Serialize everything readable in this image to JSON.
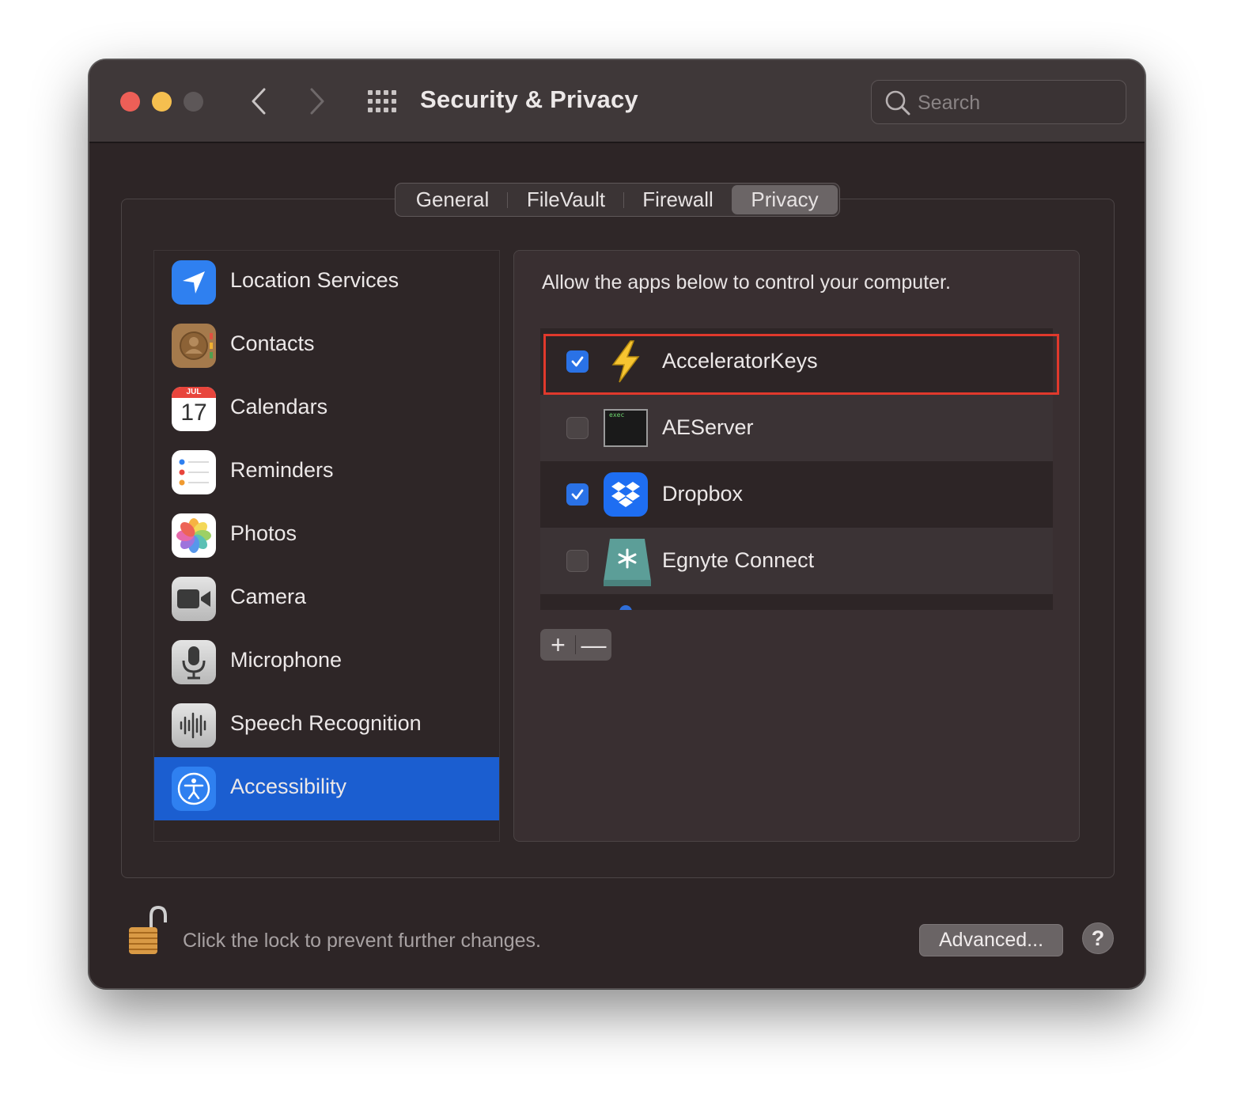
{
  "window": {
    "title": "Security & Privacy"
  },
  "toolbar": {
    "back_icon": "chevron-left-icon",
    "forward_icon": "chevron-right-icon",
    "grid_icon": "show-all-grid-icon"
  },
  "search": {
    "placeholder": "Search",
    "value": ""
  },
  "tabs": [
    {
      "label": "General",
      "selected": false
    },
    {
      "label": "FileVault",
      "selected": false
    },
    {
      "label": "Firewall",
      "selected": false
    },
    {
      "label": "Privacy",
      "selected": true
    }
  ],
  "sidebar": {
    "items": [
      {
        "label": "Location Services",
        "icon": "location-arrow-icon",
        "selected": false
      },
      {
        "label": "Contacts",
        "icon": "contacts-book-icon",
        "selected": false
      },
      {
        "label": "Calendars",
        "icon": "calendar-icon",
        "selected": false,
        "icon_month": "JUL",
        "icon_day": "17"
      },
      {
        "label": "Reminders",
        "icon": "reminders-list-icon",
        "selected": false
      },
      {
        "label": "Photos",
        "icon": "photos-flower-icon",
        "selected": false
      },
      {
        "label": "Camera",
        "icon": "camera-icon",
        "selected": false
      },
      {
        "label": "Microphone",
        "icon": "microphone-icon",
        "selected": false
      },
      {
        "label": "Speech Recognition",
        "icon": "waveform-icon",
        "selected": false
      },
      {
        "label": "Accessibility",
        "icon": "accessibility-icon",
        "selected": true
      }
    ]
  },
  "panel": {
    "heading": "Allow the apps below to control your computer.",
    "apps": [
      {
        "name": "AcceleratorKeys",
        "checked": true,
        "icon": "lightning-bolt-icon",
        "highlighted": true
      },
      {
        "name": "AEServer",
        "checked": false,
        "icon": "terminal-exec-icon",
        "icon_text": "exec"
      },
      {
        "name": "Dropbox",
        "checked": true,
        "icon": "dropbox-icon"
      },
      {
        "name": "Egnyte Connect",
        "checked": false,
        "icon": "egnyte-drive-icon"
      }
    ],
    "add_label": "+",
    "remove_label": "—"
  },
  "footer": {
    "lock_text": "Click the lock to prevent further changes.",
    "lock_icon": "unlocked-padlock-icon",
    "advanced_label": "Advanced...",
    "help_label": "?"
  },
  "colors": {
    "window_bg": "#2d2526",
    "titlebar_bg": "#3f3839",
    "selection_blue": "#1b5ed0",
    "checkbox_blue": "#2a72e6",
    "highlight_red": "#e0392c",
    "close": "#ed5f57",
    "minimize": "#f5bf4f"
  }
}
